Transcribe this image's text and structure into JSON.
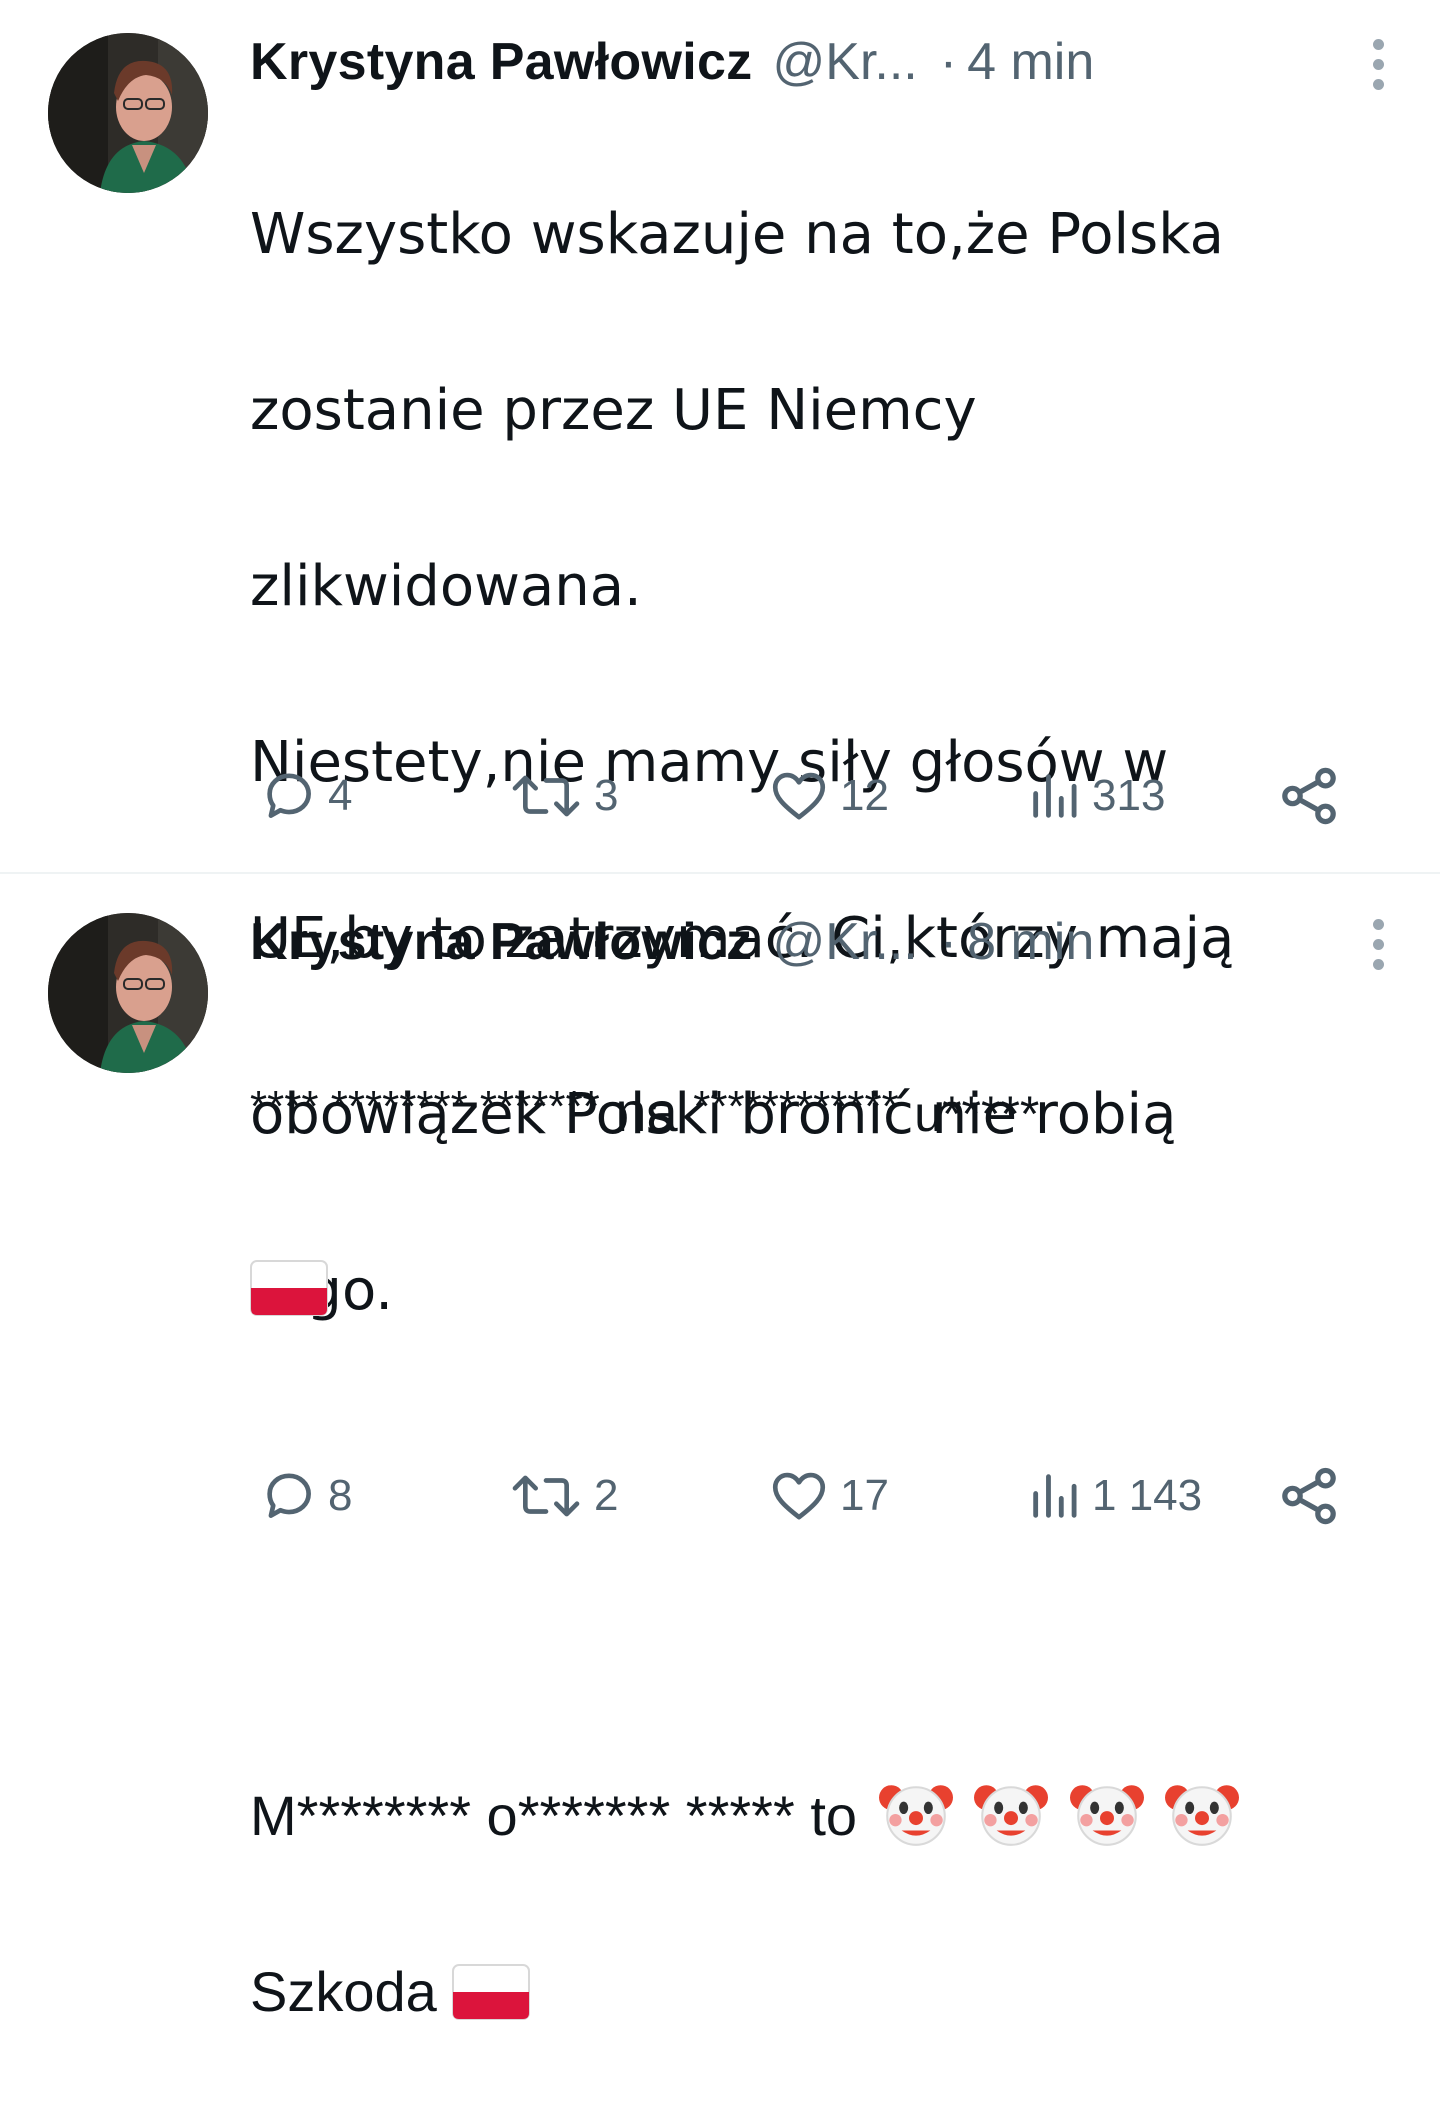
{
  "tweets": [
    {
      "author_name": "Krystyna Pawłowicz",
      "author_handle": "@Kr...",
      "separator": "·",
      "timestamp": "4 min",
      "lines": [
        "Wszystko wskazuje na to,że Polska",
        "zostanie przez UE Niemcy",
        "zlikwidowana.",
        "Niestety,nie mamy siły głosów w",
        "UE,by to zatrzymać. Ci,którzy mają",
        "obowiązek Polski bronić nie robią",
        "tego."
      ],
      "stats": {
        "replies": "4",
        "reposts": "3",
        "likes": "12",
        "views": "313"
      }
    },
    {
      "author_name": "Krystyna Pawłowicz",
      "author_handle": "@Kr...",
      "separator": "·",
      "timestamp": "8 min",
      "line1_stars": "**** ******** *******",
      "line1_word": "na",
      "line1_stars2": "************",
      "line1_u": "u*****",
      "line3_text": "M******** o******* *****",
      "line3_word": "to",
      "line4_text": "Szkoda",
      "emoji": {
        "flag": "polish-flag",
        "clown": "clown-face"
      },
      "stats": {
        "replies": "8",
        "reposts": "2",
        "likes": "17",
        "views": "1 143"
      }
    }
  ],
  "colors": {
    "text_primary": "#0f1419",
    "text_secondary": "#536471",
    "divider": "#eff3f4",
    "flag_red": "#dc143c"
  }
}
